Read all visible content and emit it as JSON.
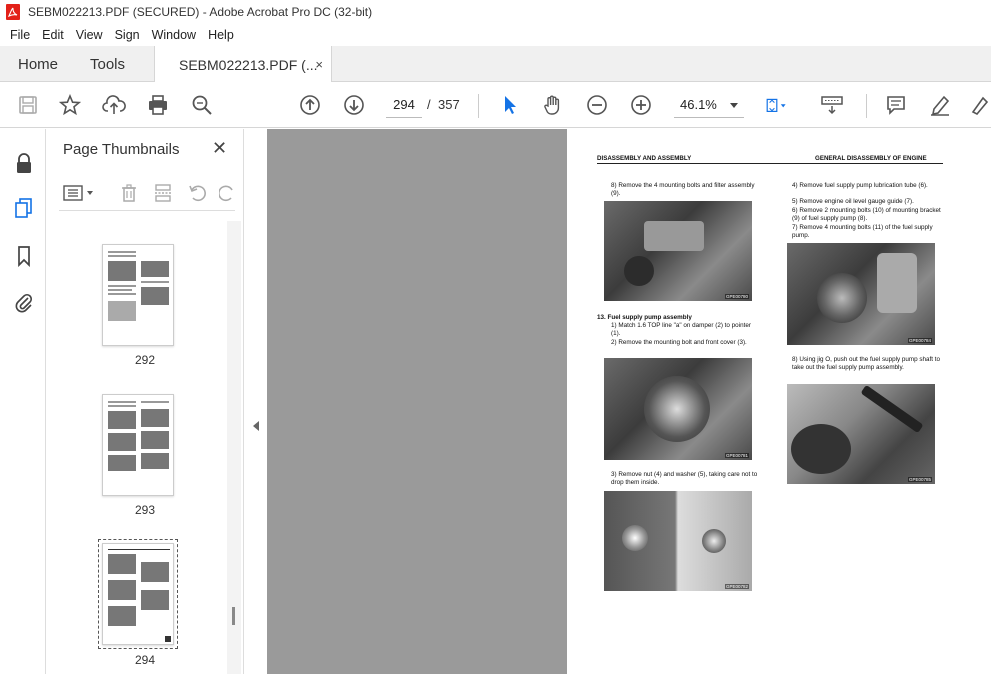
{
  "window": {
    "title": "SEBM022213.PDF (SECURED) - Adobe Acrobat Pro DC (32-bit)"
  },
  "menu": [
    "File",
    "Edit",
    "View",
    "Sign",
    "Window",
    "Help"
  ],
  "tabs": {
    "home": "Home",
    "tools": "Tools",
    "document": "SEBM022213.PDF (...",
    "close": "×"
  },
  "toolbar": {
    "page_current": "294",
    "page_sep": "/",
    "page_total": "357",
    "zoom": "46.1%"
  },
  "thumb_panel": {
    "title": "Page Thumbnails",
    "close": "✕",
    "thumbnails": [
      {
        "label": "292"
      },
      {
        "label": "293"
      },
      {
        "label": "294"
      }
    ]
  },
  "doc": {
    "header_left": "DISASSEMBLY AND ASSEMBLY",
    "header_right": "GENERAL DISASSEMBLY OF ENGINE",
    "step8a": "8)  Remove the 4 mounting bolts and filter assembly (9).",
    "photo1_code": "GPE00780",
    "section13": "13. Fuel supply pump assembly",
    "s13_1": "1)  Match 1.6 TOP line \"a\" on damper (2) to pointer (1).",
    "s13_2": "2)  Remove the mounting bolt and front cover (3).",
    "photo2_code": "GPE00781",
    "s13_3": "3)  Remove nut (4) and washer (5), taking care not to drop them inside.",
    "photo3_code": "GPE00782",
    "r4": "4)  Remove fuel supply pump lubrication tube (6).",
    "r5": "5)  Remove engine oil level gauge guide (7).",
    "r6": "6)  Remove 2 mounting bolts (10) of mounting bracket (9) of fuel supply pump (8).",
    "r7": "7)  Remove 4 mounting bolts (11) of the fuel supply pump.",
    "photo4_code": "GPE00784",
    "r8": "8)  Using jig O, push out the fuel supply pump shaft to take out the fuel supply pump assembly.",
    "photo5_code": "GPE00785"
  },
  "colors": {
    "accent_blue": "#1473e6",
    "acrobat_red": "#e32119",
    "doc_bg": "#9a9a9a"
  }
}
